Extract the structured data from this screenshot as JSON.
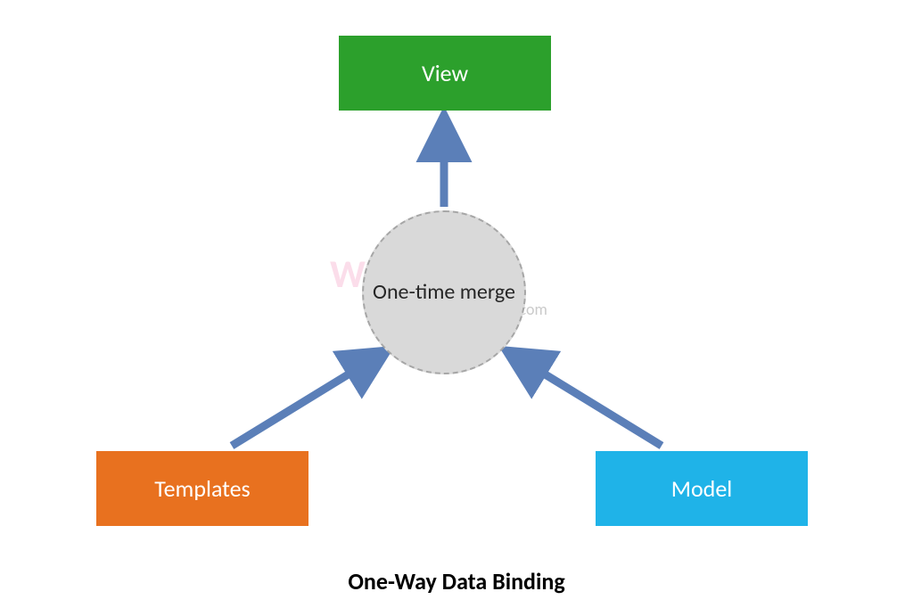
{
  "diagram": {
    "title": "One-Way Data Binding",
    "nodes": {
      "view": {
        "label": "View",
        "color": "#2CA02C"
      },
      "templates": {
        "label": "Templates",
        "color": "#E8711F"
      },
      "model": {
        "label": "Model",
        "color": "#1FB3E8"
      },
      "merge": {
        "label": "One-time merge",
        "shape": "circle-dashed",
        "fill": "#D9D9D9"
      }
    },
    "edges": [
      {
        "from": "templates",
        "to": "merge",
        "style": "arrow",
        "color": "#5B7FB8"
      },
      {
        "from": "model",
        "to": "merge",
        "style": "arrow",
        "color": "#5B7FB8"
      },
      {
        "from": "merge",
        "to": "view",
        "style": "arrow",
        "color": "#5B7FB8"
      }
    ],
    "arrow_color": "#5B7FB8"
  },
  "watermark": {
    "text": "Wikitechy",
    "suffix": ".com"
  }
}
